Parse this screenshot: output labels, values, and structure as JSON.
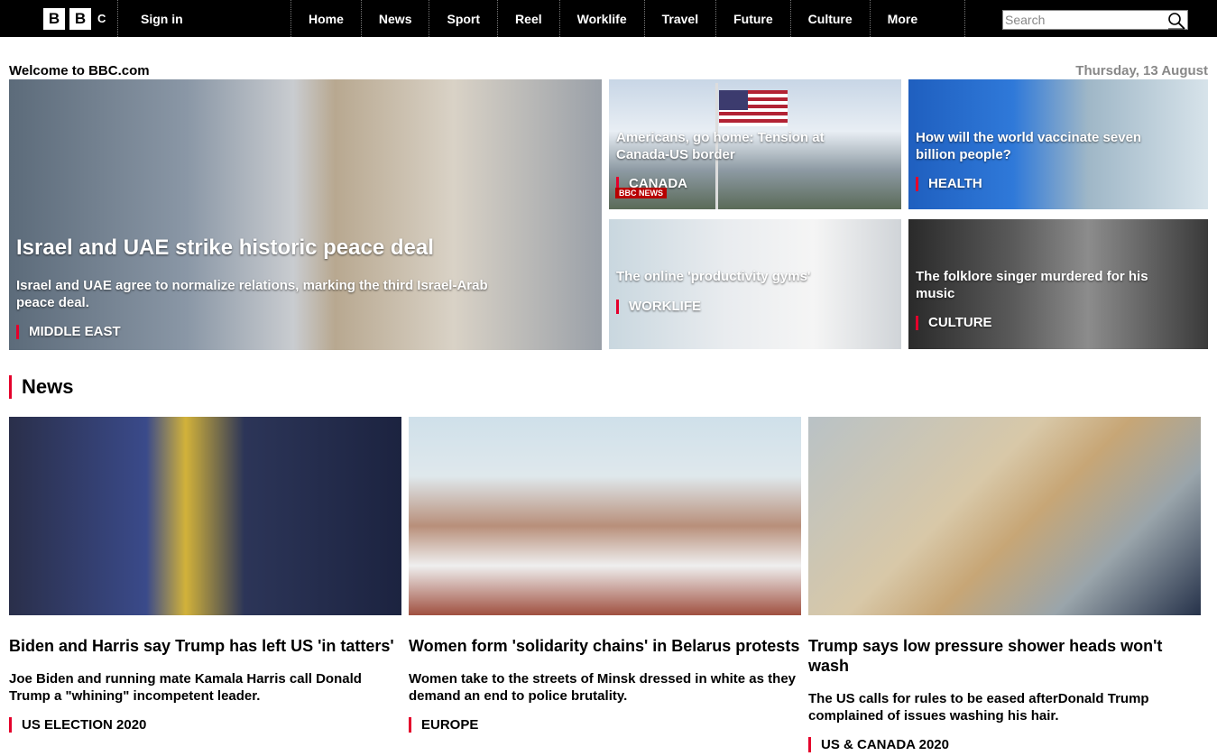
{
  "header": {
    "logo_letters": [
      "B",
      "B"
    ],
    "logo_suffix": "C",
    "sign_in": "Sign in",
    "nav": [
      "Home",
      "News",
      "Sport",
      "Reel",
      "Worklife",
      "Travel",
      "Future",
      "Culture",
      "More"
    ],
    "search_placeholder": "Search"
  },
  "welcome": "Welcome to BBC.com",
  "date": "Thursday, 13 August",
  "hero": {
    "title": "Israel and UAE strike historic peace deal",
    "summary": "Israel and UAE agree to normalize relations, marking the third Israel-Arab peace deal.",
    "tag": "MIDDLE EAST"
  },
  "promos": [
    {
      "title": "Americans, go home: Tension at Canada-US border",
      "tag": "CANADA",
      "badge": "BBC NEWS"
    },
    {
      "title": "How will the world vaccinate seven billion people?",
      "tag": "HEALTH"
    },
    {
      "title": "The online 'productivity gyms'",
      "tag": "WORKLIFE"
    },
    {
      "title": "The folklore singer murdered for his music",
      "tag": "CULTURE"
    }
  ],
  "news_section": "News",
  "news": [
    {
      "headline": "Biden and Harris say Trump has left US 'in tatters'",
      "summary": "Joe Biden and running mate Kamala Harris call Donald Trump a \"whining\" incompetent leader.",
      "tag": "US ELECTION 2020"
    },
    {
      "headline": "Women form 'solidarity chains' in Belarus protests",
      "summary": "Women take to the streets of Minsk dressed in white as they demand an end to police brutality.",
      "tag": "EUROPE"
    },
    {
      "headline": "Trump says low pressure shower heads won't wash",
      "summary": "The US calls for rules to be eased afterDonald Trump complained of issues washing his hair.",
      "tag": "US & CANADA 2020"
    }
  ]
}
